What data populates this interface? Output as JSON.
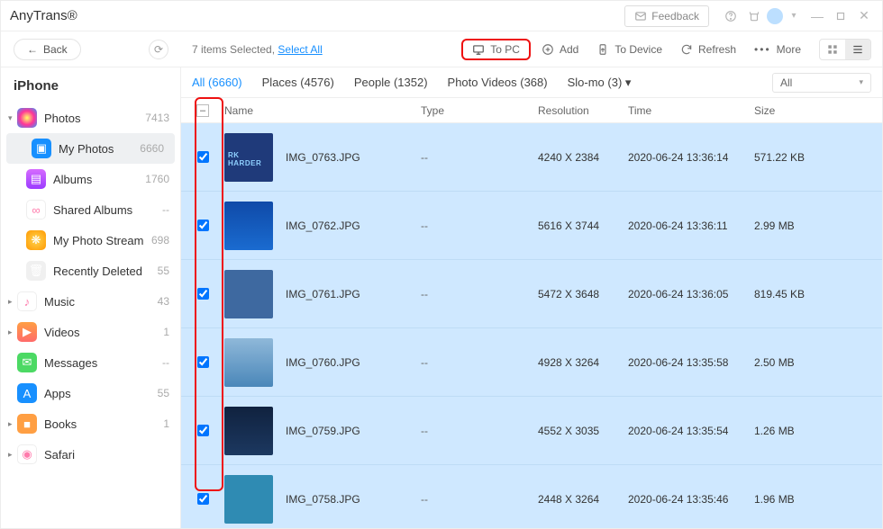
{
  "app": {
    "title": "AnyTrans®",
    "feedback": "Feedback"
  },
  "topbar": {
    "back": "Back"
  },
  "toolbar": {
    "selected_text": "7 items Selected, ",
    "select_all": "Select All",
    "to_pc": "To PC",
    "add": "Add",
    "to_device": "To Device",
    "refresh": "Refresh",
    "more": "More"
  },
  "sidebar": {
    "device": "iPhone",
    "items": [
      {
        "label": "Photos",
        "count": "7413",
        "icon": "photos",
        "exp": true
      },
      {
        "label": "My Photos",
        "count": "6660",
        "icon": "myphotos",
        "sub": true,
        "sel": true
      },
      {
        "label": "Albums",
        "count": "1760",
        "icon": "albums",
        "sub": true
      },
      {
        "label": "Shared Albums",
        "count": "--",
        "icon": "shared",
        "sub": true
      },
      {
        "label": "My Photo Stream",
        "count": "698",
        "icon": "stream",
        "sub": true
      },
      {
        "label": "Recently Deleted",
        "count": "55",
        "icon": "trash",
        "sub": true
      },
      {
        "label": "Music",
        "count": "43",
        "icon": "music",
        "exp": false
      },
      {
        "label": "Videos",
        "count": "1",
        "icon": "videos",
        "exp": false
      },
      {
        "label": "Messages",
        "count": "--",
        "icon": "messages"
      },
      {
        "label": "Apps",
        "count": "55",
        "icon": "apps"
      },
      {
        "label": "Books",
        "count": "1",
        "icon": "books",
        "exp": false
      },
      {
        "label": "Safari",
        "count": "",
        "icon": "safari",
        "exp": false
      }
    ]
  },
  "tabs": {
    "items": [
      "All (6660)",
      "Places (4576)",
      "People (1352)",
      "Photo Videos (368)",
      "Slo-mo (3) ▾"
    ],
    "filter": "All"
  },
  "table": {
    "headers": {
      "name": "Name",
      "type": "Type",
      "res": "Resolution",
      "time": "Time",
      "size": "Size"
    },
    "rows": [
      {
        "name": "IMG_0763.JPG",
        "type": "--",
        "res": "4240 X 2384",
        "time": "2020-06-24 13:36:14",
        "size": "571.22 KB",
        "thumb": "neon",
        "chk": true
      },
      {
        "name": "IMG_0762.JPG",
        "type": "--",
        "res": "5616 X 3744",
        "time": "2020-06-24 13:36:11",
        "size": "2.99 MB",
        "thumb": "sea",
        "chk": true
      },
      {
        "name": "IMG_0761.JPG",
        "type": "--",
        "res": "5472 X 3648",
        "time": "2020-06-24 13:36:05",
        "size": "819.45 KB",
        "thumb": "plain",
        "chk": true
      },
      {
        "name": "IMG_0760.JPG",
        "type": "--",
        "res": "4928 X 3264",
        "time": "2020-06-24 13:35:58",
        "size": "2.50 MB",
        "thumb": "sky",
        "chk": true
      },
      {
        "name": "IMG_0759.JPG",
        "type": "--",
        "res": "4552 X 3035",
        "time": "2020-06-24 13:35:54",
        "size": "1.26 MB",
        "thumb": "dark",
        "chk": true
      },
      {
        "name": "IMG_0758.JPG",
        "type": "--",
        "res": "2448 X 3264",
        "time": "2020-06-24 13:35:46",
        "size": "1.96 MB",
        "thumb": "colorful",
        "chk": true
      }
    ]
  },
  "icons": {
    "photos": {
      "bg": "radial-gradient(circle,#ff6,#f39,#39f)"
    },
    "myphotos": {
      "bg": "#1890ff"
    },
    "albums": {
      "bg": "linear-gradient(#d66bff,#9b3cff)"
    },
    "shared": {
      "bg": "#fff",
      "border": "#eee"
    },
    "stream": {
      "bg": "radial-gradient(circle,#ffd54f,#ff9800)"
    },
    "trash": {
      "bg": "#f0f0f0"
    },
    "music": {
      "bg": "#fff",
      "border": "#eee"
    },
    "videos": {
      "bg": "linear-gradient(#ff9f43,#ff6b6b)"
    },
    "messages": {
      "bg": "#4cd964"
    },
    "apps": {
      "bg": "#1890ff"
    },
    "books": {
      "bg": "#ff9f43"
    },
    "safari": {
      "bg": "#fff",
      "border": "#eee"
    }
  }
}
